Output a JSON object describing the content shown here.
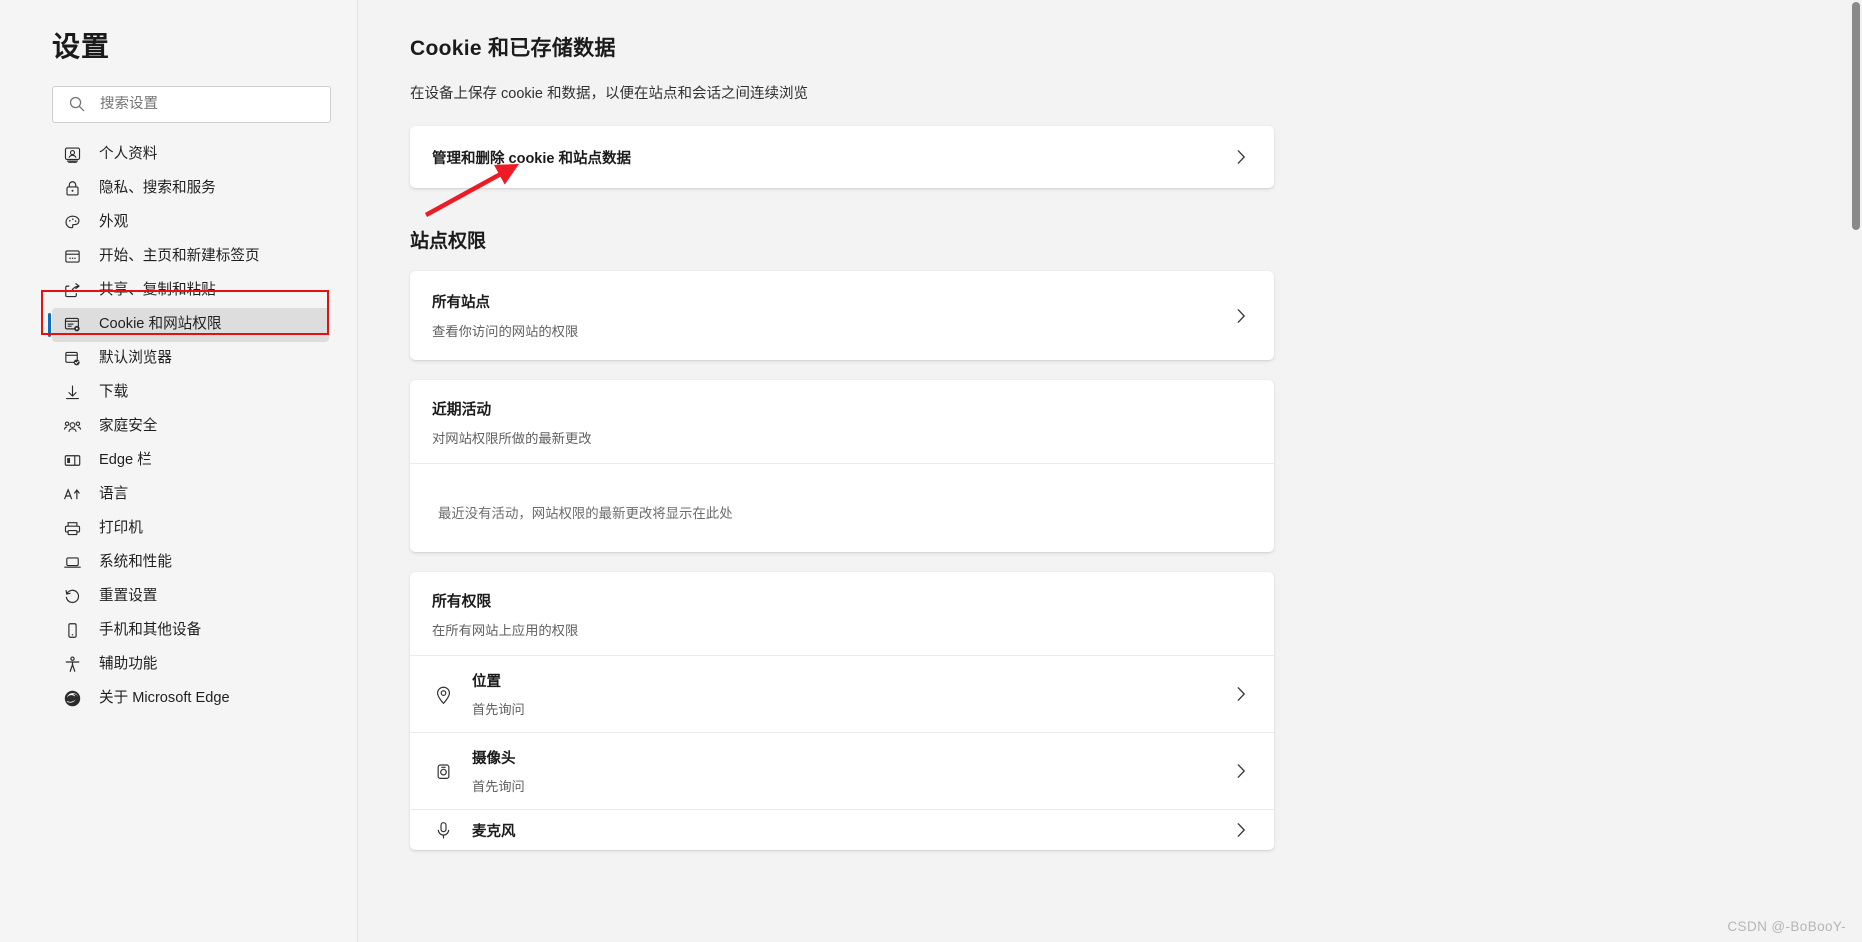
{
  "sidebar": {
    "title": "设置",
    "search": {
      "placeholder": "搜索设置",
      "value": "",
      "icon": "search-icon"
    },
    "items": [
      {
        "label": "个人资料",
        "icon": "profile-icon",
        "selected": false
      },
      {
        "label": "隐私、搜索和服务",
        "icon": "lock-icon",
        "selected": false
      },
      {
        "label": "外观",
        "icon": "palette-icon",
        "selected": false
      },
      {
        "label": "开始、主页和新建标签页",
        "icon": "browser-window-icon",
        "selected": false
      },
      {
        "label": "共享、复制和粘贴",
        "icon": "share-icon",
        "selected": false
      },
      {
        "label": "Cookie 和网站权限",
        "icon": "cookie-settings-icon",
        "selected": true
      },
      {
        "label": "默认浏览器",
        "icon": "default-browser-icon",
        "selected": false
      },
      {
        "label": "下载",
        "icon": "download-icon",
        "selected": false
      },
      {
        "label": "家庭安全",
        "icon": "family-icon",
        "selected": false
      },
      {
        "label": "Edge 栏",
        "icon": "edge-bar-icon",
        "selected": false
      },
      {
        "label": "语言",
        "icon": "language-icon",
        "selected": false
      },
      {
        "label": "打印机",
        "icon": "printer-icon",
        "selected": false
      },
      {
        "label": "系统和性能",
        "icon": "laptop-icon",
        "selected": false
      },
      {
        "label": "重置设置",
        "icon": "reset-icon",
        "selected": false
      },
      {
        "label": "手机和其他设备",
        "icon": "phone-icon",
        "selected": false
      },
      {
        "label": "辅助功能",
        "icon": "accessibility-icon",
        "selected": false
      },
      {
        "label": "关于 Microsoft Edge",
        "icon": "edge-logo-icon",
        "selected": false
      }
    ]
  },
  "main": {
    "page_title": "Cookie 和已存储数据",
    "page_subtitle": "在设备上保存 cookie 和数据，以便在站点和会话之间连续浏览",
    "manage_cookies": {
      "label": "管理和删除 cookie 和站点数据",
      "chevron": "chevron-right-icon"
    },
    "site_permissions_heading": "站点权限",
    "all_sites": {
      "title": "所有站点",
      "desc": "查看你访问的网站的权限",
      "chevron": "chevron-right-icon"
    },
    "recent_activity": {
      "title": "近期活动",
      "desc": "对网站权限所做的最新更改",
      "empty": "最近没有活动，网站权限的最新更改将显示在此处"
    },
    "all_permissions": {
      "title": "所有权限",
      "desc": "在所有网站上应用的权限",
      "items": [
        {
          "title": "位置",
          "desc": "首先询问",
          "icon": "location-pin-icon",
          "chevron": "chevron-right-icon"
        },
        {
          "title": "摄像头",
          "desc": "首先询问",
          "icon": "camera-icon",
          "chevron": "chevron-right-icon"
        },
        {
          "title": "麦克风",
          "desc": "",
          "icon": "microphone-icon",
          "chevron": "chevron-right-icon"
        }
      ]
    }
  },
  "annotations": {
    "arrow_color": "#ee1b24",
    "highlight_color": "#e8100f"
  },
  "watermark": "CSDN @-BoBooY-",
  "colors": {
    "accent": "#0f6cbd",
    "sidebar_bg": "#f5f5f5",
    "content_bg": "#f3f3f3",
    "card_bg": "#ffffff"
  }
}
